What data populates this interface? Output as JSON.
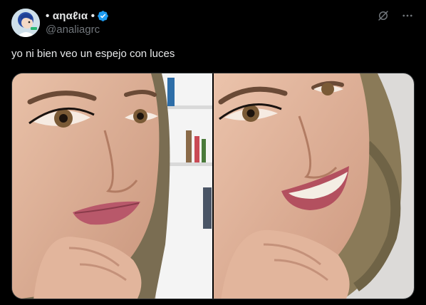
{
  "author": {
    "display_name": "• αηαℓια •",
    "handle": "@analiagrc",
    "verified": true
  },
  "post": {
    "text": "yo ni bien veo un espejo con luces"
  },
  "media": {
    "photos": [
      {
        "alt": "photo-1"
      },
      {
        "alt": "photo-2"
      }
    ]
  },
  "icons": {
    "grok": "grok-icon",
    "more": "more-icon",
    "verified": "verified-badge-icon"
  },
  "colors": {
    "background": "#000000",
    "text_primary": "#e7e9ea",
    "text_secondary": "#71767b",
    "verified_blue": "#1d9bf0",
    "border": "#2f3336"
  }
}
